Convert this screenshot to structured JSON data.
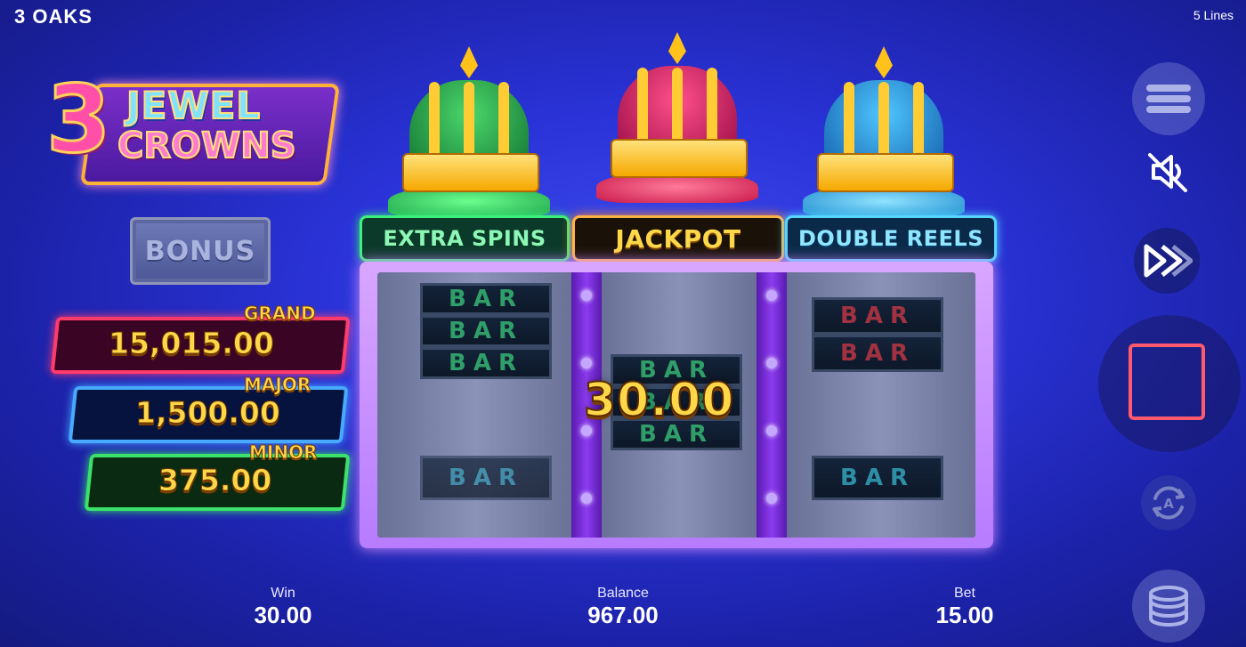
{
  "header": {
    "brand": "3 OAKS",
    "lines": "5 Lines"
  },
  "logo": {
    "digit": "3",
    "line1": "JEWEL",
    "line2": "CROWNS"
  },
  "bonus": {
    "label": "BONUS"
  },
  "jackpots": [
    {
      "name": "GRAND",
      "value": "15,015.00"
    },
    {
      "name": "MAJOR",
      "value": "1,500.00"
    },
    {
      "name": "MINOR",
      "value": "375.00"
    }
  ],
  "features": [
    {
      "label": "EXTRA SPINS",
      "color": "#3df07c"
    },
    {
      "label": "JACKPOT",
      "color": "#ffb347"
    },
    {
      "label": "DOUBLE REELS",
      "color": "#55d6ff"
    }
  ],
  "reels": {
    "symbol": "BAR",
    "win_amount": "30.00"
  },
  "footer": {
    "win_label": "Win",
    "win_value": "30.00",
    "balance_label": "Balance",
    "balance_value": "967.00",
    "bet_label": "Bet",
    "bet_value": "15.00"
  },
  "controls": {
    "menu_icon": "hamburger-icon",
    "sound_icon": "speaker-muted-icon",
    "turbo_icon": "fast-forward-icon",
    "spin_icon": "stop-square-icon",
    "autoplay_icon": "autoplay-icon",
    "bet_icon": "coin-stack-icon"
  },
  "colors": {
    "grand": "#ff3b6b",
    "major": "#47a9ff",
    "minor": "#3be26a",
    "win_text": "#ffd84a"
  }
}
